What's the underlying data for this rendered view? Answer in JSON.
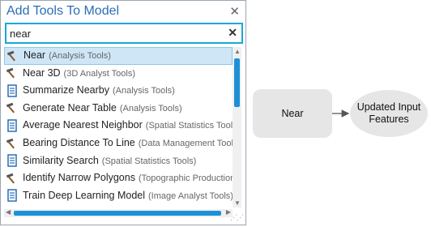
{
  "dialog": {
    "title": "Add Tools To Model",
    "close_glyph": "✕",
    "search": {
      "value": "near",
      "clear_glyph": "✕"
    },
    "results": [
      {
        "name": "Near",
        "category": "(Analysis Tools)",
        "icon": "hammer-icon",
        "selected": true
      },
      {
        "name": "Near 3D",
        "category": "(3D Analyst Tools)",
        "icon": "hammer-icon",
        "selected": false
      },
      {
        "name": "Summarize Nearby",
        "category": "(Analysis Tools)",
        "icon": "script-icon",
        "selected": false
      },
      {
        "name": "Generate Near Table",
        "category": "(Analysis Tools)",
        "icon": "hammer-icon",
        "selected": false
      },
      {
        "name": "Average Nearest Neighbor",
        "category": "(Spatial Statistics Tools)",
        "icon": "script-icon",
        "selected": false
      },
      {
        "name": "Bearing Distance To Line",
        "category": "(Data Management Tools)",
        "icon": "hammer-icon",
        "selected": false
      },
      {
        "name": "Similarity Search",
        "category": "(Spatial Statistics Tools)",
        "icon": "script-icon",
        "selected": false
      },
      {
        "name": "Identify Narrow Polygons",
        "category": "(Topographic Production T",
        "icon": "hammer-icon",
        "selected": false
      },
      {
        "name": "Train Deep Learning Model",
        "category": "(Image Analyst Tools)",
        "icon": "script-icon",
        "selected": false
      }
    ]
  },
  "model": {
    "tool_node": "Near",
    "output_node_line1": "Updated Input",
    "output_node_line2": "Features"
  },
  "colors": {
    "title": "#2a6fb6",
    "search_border": "#1aa7d8",
    "selection": "#cfe6f7",
    "scroll_thumb": "#1e90d8",
    "tool_node_fill": "#e6e6e6",
    "output_node_fill": "#e6e6e6"
  }
}
